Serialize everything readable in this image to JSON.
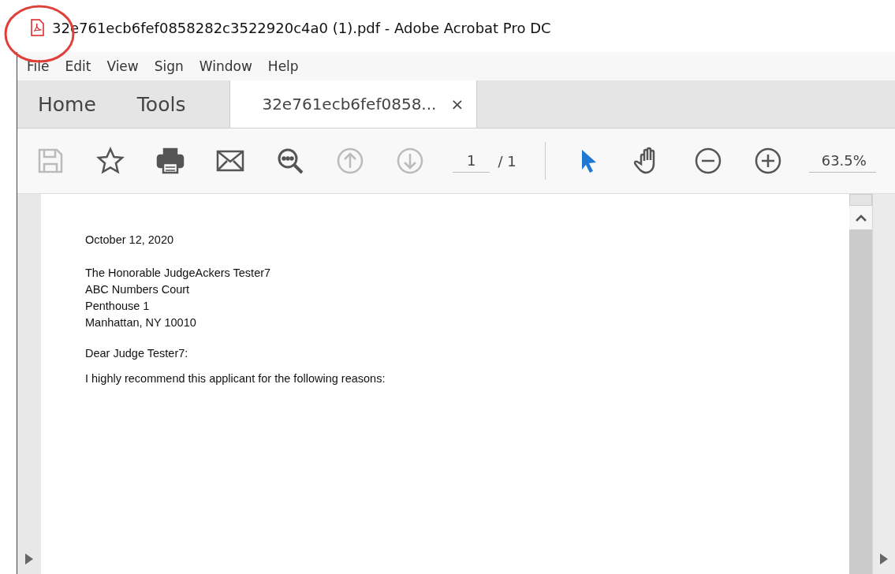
{
  "window": {
    "title": "32e761ecb6fef0858282c3522920c4a0 (1).pdf - Adobe Acrobat Pro DC"
  },
  "menu": [
    "File",
    "Edit",
    "View",
    "Sign",
    "Window",
    "Help"
  ],
  "tabs": [
    {
      "label": "Home",
      "selected": false
    },
    {
      "label": "Tools",
      "selected": false
    },
    {
      "label": "32e761ecb6fef0858...",
      "selected": true,
      "close": "×"
    }
  ],
  "toolbar": [
    {
      "kind": "save",
      "disabled": true
    },
    {
      "kind": "star",
      "disabled": false
    },
    {
      "kind": "print",
      "disabled": false
    },
    {
      "kind": "mail",
      "disabled": false
    },
    {
      "kind": "find",
      "disabled": false
    },
    {
      "kind": "up",
      "disabled": true
    },
    {
      "kind": "down",
      "disabled": true
    }
  ],
  "page": {
    "value": "1",
    "total": "/ 1"
  },
  "tools": [
    {
      "kind": "select",
      "selected": true
    },
    {
      "kind": "hand",
      "selected": false
    },
    {
      "kind": "zoomout",
      "selected": false
    },
    {
      "kind": "zoomin",
      "selected": false
    }
  ],
  "zoom": {
    "value": "63.5%"
  },
  "document": {
    "date": "October 12, 2020",
    "address": [
      "The Honorable JudgeAckers Tester7",
      "ABC Numbers Court",
      "Penthouse 1",
      "Manhattan, NY 10010"
    ],
    "salutation": "Dear Judge Tester7:",
    "body": "I highly recommend this applicant for the following reasons:"
  },
  "annotation": {
    "kind": "circle"
  }
}
